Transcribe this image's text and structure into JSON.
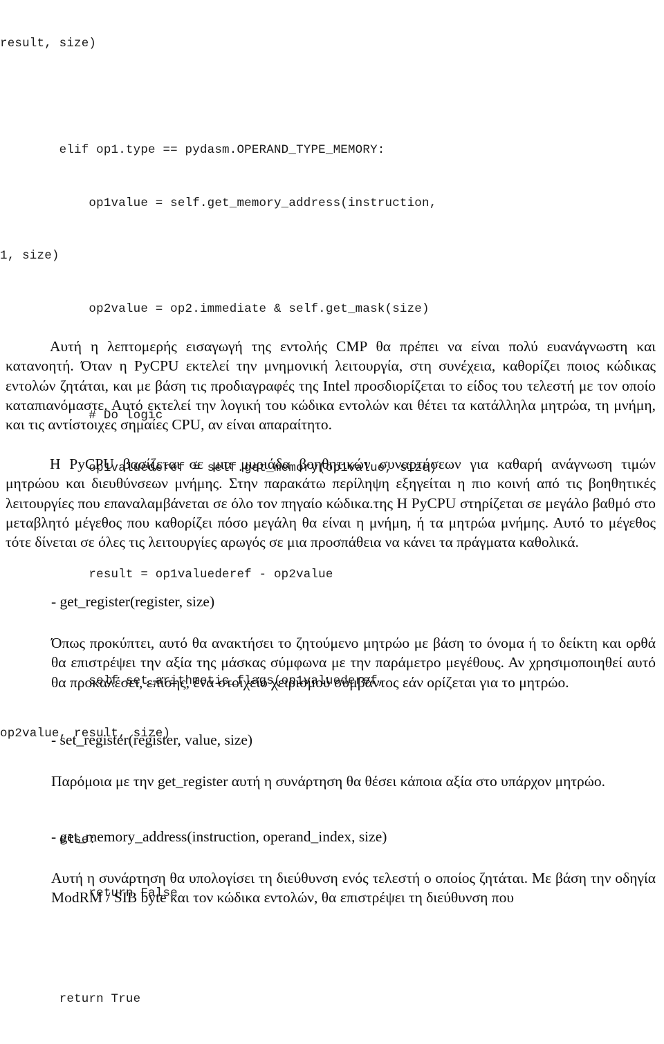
{
  "document": {
    "code_block": {
      "language": "python",
      "lines": [
        "result, size)",
        "",
        "        elif op1.type == pydasm.OPERAND_TYPE_MEMORY:",
        "            op1value = self.get_memory_address(instruction,",
        "1, size)",
        "            op2value = op2.immediate & self.get_mask(size)",
        "",
        "            # Do logic",
        "            op1valuederef = self.get_memory(op1value, size)",
        "",
        "            result = op1valuederef - op2value",
        "",
        "            self.set_arithmetic_flags(op1valuederef,",
        "op2value, result, size)",
        "",
        "        else:",
        "            return False",
        "",
        "        return True"
      ]
    },
    "paragraphs": {
      "cmp_intro": "Αυτή η λεπτομερής εισαγωγή της εντολής CMP θα πρέπει να είναι πολύ ευανάγνωστη και κατανοητή. Όταν η PyCPU εκτελεί την μνημονική λειτουργία, στη συνέχεια, καθορίζει ποιος κώδικας εντολών ζητάται, και με βάση τις προδιαγραφές της Intel προσδιορίζεται το είδος του τελεστή με τον οποίο καταπιανόμαστε. Αυτό εκτελεί την λογική του κώδικα εντολών και θέτει τα κατάλληλα μητρώα, τη μνήμη, και τις αντίστοιχες σημαίες CPU, αν είναι απαραίτητο.",
      "pycpu_helpers": "Η PyCPU βασίζεται σε μια μυριάδα βοηθητικών συναρτήσεων για καθαρή ανάγνωση τιμών μητρώου και διευθύνσεων μνήμης. Στην παρακάτω περίληψη εξηγείται η πιο κοινή από τις βοηθητικές λειτουργίες που επαναλαμβάνεται σε όλο τον πηγαίο κώδικα.της Η PyCPU στηρίζεται σε μεγάλο βαθμό στο μεταβλητό μέγεθος που καθορίζει πόσο μεγάλη  θα είναι η μνήμη, ή τα μητρώα μνήμης. Αυτό το μέγεθος τότε δίνεται σε όλες τις λειτουργίες αρωγός σε μια προσπάθεια να κάνει τα πράγματα καθολικά.",
      "get_register_desc": "Όπως προκύπτει, αυτό θα ανακτήσει το ζητούμενο μητρώο με βάση το όνομα ή το δείκτη και ορθά θα επιστρέψει την αξία της μάσκας σύμφωνα με την παράμετρο μεγέθους. Αν χρησιμοποιηθεί αυτό θα προκαλέσει, επίσης, ένα στοιχείο χειρισμού συμβάντος εάν ορίζεται για το μητρώο.",
      "set_register_desc": "Παρόμοια με την get_register αυτή η συνάρτηση θα θέσει κάποια αξία στο υπάρχον μητρώο.",
      "get_memory_address_desc": "Αυτή η συνάρτηση θα υπολογίσει τη διεύθυνση ενός τελεστή ο οποίος ζητάται. Με βάση την οδηγία ModRM / SIB byte και τον κώδικα εντολών, θα επιστρέψει τη διεύθυνση που"
    },
    "headings": {
      "get_register": "- get_register(register, size)",
      "set_register": "- set_register(register, value, size)",
      "get_memory_address": "- get_memory_address(instruction, operand_index, size)"
    },
    "colors": {
      "page_background": "#ffffff",
      "text": "#0d0d0d",
      "code_text": "#1a1a1a"
    }
  }
}
